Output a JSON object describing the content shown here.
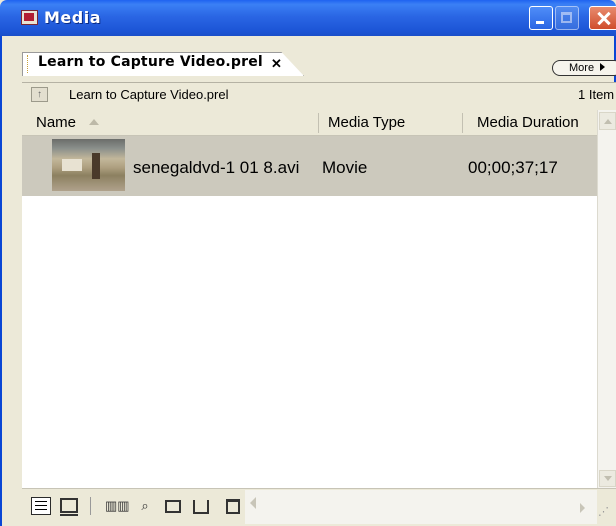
{
  "window": {
    "title": "Media",
    "colors": {
      "titlebar": "#2a66e4",
      "close_button": "#d04d2c",
      "selected_row": "#ccc9bd"
    }
  },
  "tab": {
    "label": "Learn to Capture Video.prel",
    "close_glyph": "✕"
  },
  "more_button": {
    "label": "More"
  },
  "path_bar": {
    "path": "Learn to Capture Video.prel",
    "item_count": "1 Item"
  },
  "columns": [
    "Name",
    "Media Type",
    "Media Duration"
  ],
  "rows": [
    {
      "name": "senegaldvd-1 01 8.avi",
      "type": "Movie",
      "duration": "00;00;37;17"
    }
  ],
  "toolbar": {
    "icons": [
      "list-view-icon",
      "icon-view-icon",
      "bins-icon",
      "find-icon",
      "new-bin-icon",
      "new-item-icon",
      "trash-icon"
    ]
  }
}
